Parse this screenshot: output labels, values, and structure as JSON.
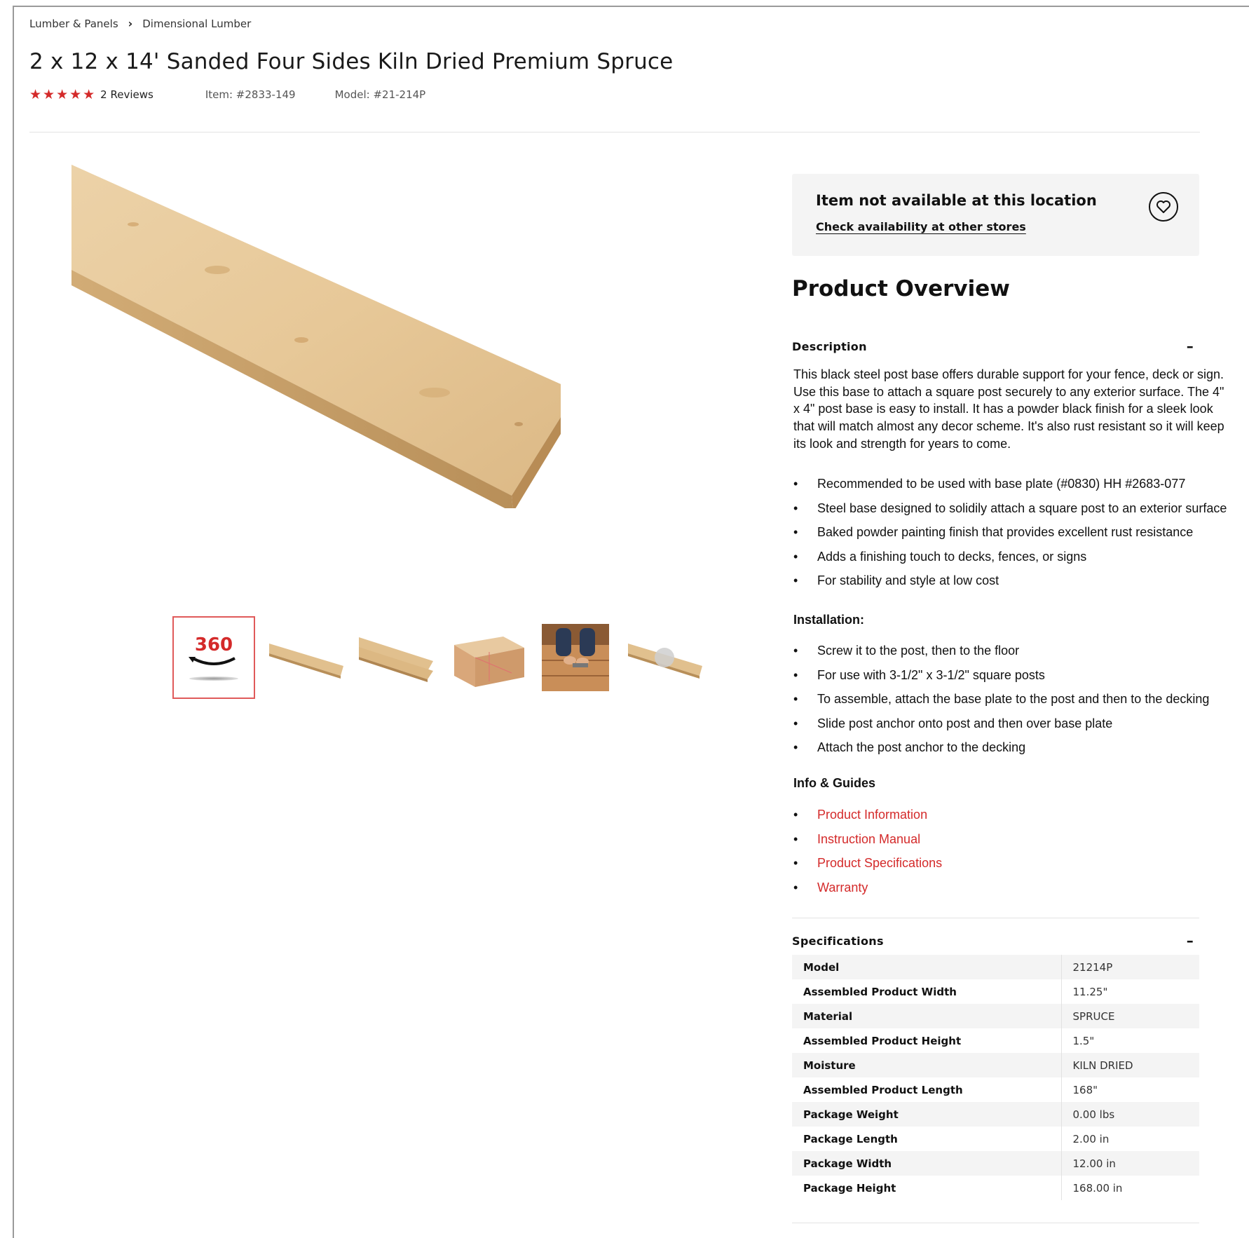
{
  "breadcrumb": {
    "items": [
      "Lumber & Panels",
      "Dimensional Lumber"
    ],
    "separator": "›"
  },
  "product": {
    "title": "2 x 12 x 14' Sanded Four Sides Kiln Dried Premium Spruce",
    "rating": 5,
    "rating_max": 5,
    "reviews_label": "2 Reviews",
    "item_label": "Item: #2833-149",
    "model_label": "Model: #21-214P"
  },
  "gallery": {
    "thumb_360_label": "360",
    "thumbnails": [
      "360-view-icon",
      "board-thumb",
      "boards-stacked-thumb",
      "board-dimensions-thumb",
      "installation-photo-thumb",
      "board-video-thumb"
    ]
  },
  "availability": {
    "title": "Item not available at this location",
    "link": "Check availability at other stores"
  },
  "overview": {
    "title": "Product Overview",
    "description_head": "Description",
    "description_text": "This black steel post base offers durable support for your fence, deck or sign. Use this base to attach a square post securely to any exterior surface. The 4\" x 4\" post base is easy to install. It has a powder black finish for a sleek look that will match almost any decor scheme. It's also rust resistant so it will keep its look and strength for years to come.",
    "features": [
      "Recommended to be used with base plate (#0830) HH #2683-077",
      "Steel base designed to solidily attach a square post to an exterior surface",
      "Baked powder painting finish that provides excellent rust resistance",
      "Adds a finishing touch to decks, fences, or signs",
      "For stability and style at low cost"
    ],
    "installation_head": "Installation:",
    "installation": [
      "Screw it to the post, then to the floor",
      "For use with 3-1/2\" x 3-1/2\" square posts",
      "To assemble, attach the base plate to the post and then to the decking",
      "Slide post anchor onto post and then over base plate",
      "Attach the post anchor to the decking"
    ],
    "guides_head": "Info & Guides",
    "guides": [
      "Product Information",
      "Instruction Manual",
      "Product Specifications",
      "Warranty"
    ],
    "toggle_symbol": "–"
  },
  "specifications": {
    "head": "Specifications",
    "rows": [
      {
        "key": "Model",
        "value": "21214P"
      },
      {
        "key": "Assembled Product Width",
        "value": "11.25\""
      },
      {
        "key": "Material",
        "value": "SPRUCE"
      },
      {
        "key": "Assembled Product Height",
        "value": "1.5\""
      },
      {
        "key": "Moisture",
        "value": "KILN DRIED"
      },
      {
        "key": "Assembled Product Length",
        "value": "168\""
      },
      {
        "key": "Package Weight",
        "value": "0.00 lbs"
      },
      {
        "key": "Package Length",
        "value": "2.00 in"
      },
      {
        "key": "Package Width",
        "value": "12.00 in"
      },
      {
        "key": "Package Height",
        "value": "168.00 in"
      }
    ]
  },
  "colors": {
    "accent_red": "#d42a2a",
    "panel_gray": "#f4f4f4",
    "wood_light": "#e6c79a",
    "wood_edge": "#c9a06a"
  }
}
